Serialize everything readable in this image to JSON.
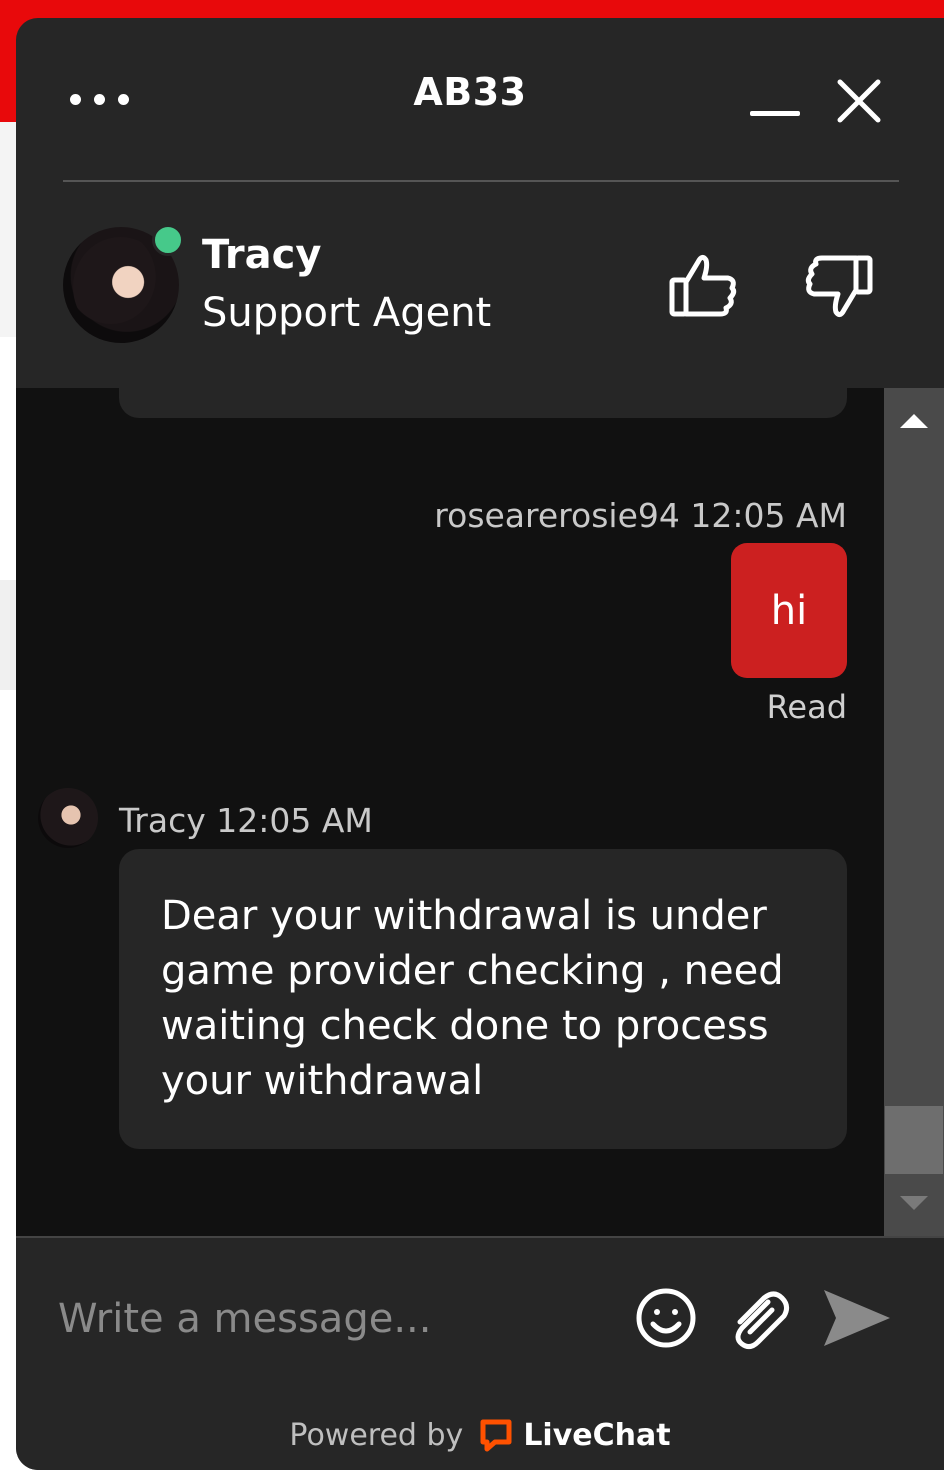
{
  "header": {
    "title": "AB33",
    "menu_icon": "more-dots-icon",
    "minimize_icon": "minimize-icon",
    "close_icon": "close-icon"
  },
  "agent": {
    "name": "Tracy",
    "role": "Support Agent",
    "status": "online",
    "status_color": "#46c98a",
    "rate_good_icon": "thumbs-up-icon",
    "rate_bad_icon": "thumbs-down-icon"
  },
  "messages": [
    {
      "author": "rosearerosie94",
      "time": "12:05 AM",
      "meta": "rosearerosie94 12:05 AM",
      "text": "hi",
      "receipt": "Read",
      "bubble_color": "#cc2020"
    },
    {
      "author": "Tracy",
      "time": "12:05 AM",
      "meta": "Tracy 12:05 AM",
      "text": "Dear your withdrawal is under game provider checking , need waiting check done to process your withdrawal"
    }
  ],
  "composer": {
    "placeholder": "Write a message...",
    "emoji_icon": "smiley-icon",
    "attach_icon": "paperclip-icon",
    "send_icon": "send-icon"
  },
  "footer": {
    "powered_by": "Powered by",
    "brand": "LiveChat",
    "brand_color": "#ff5100"
  }
}
